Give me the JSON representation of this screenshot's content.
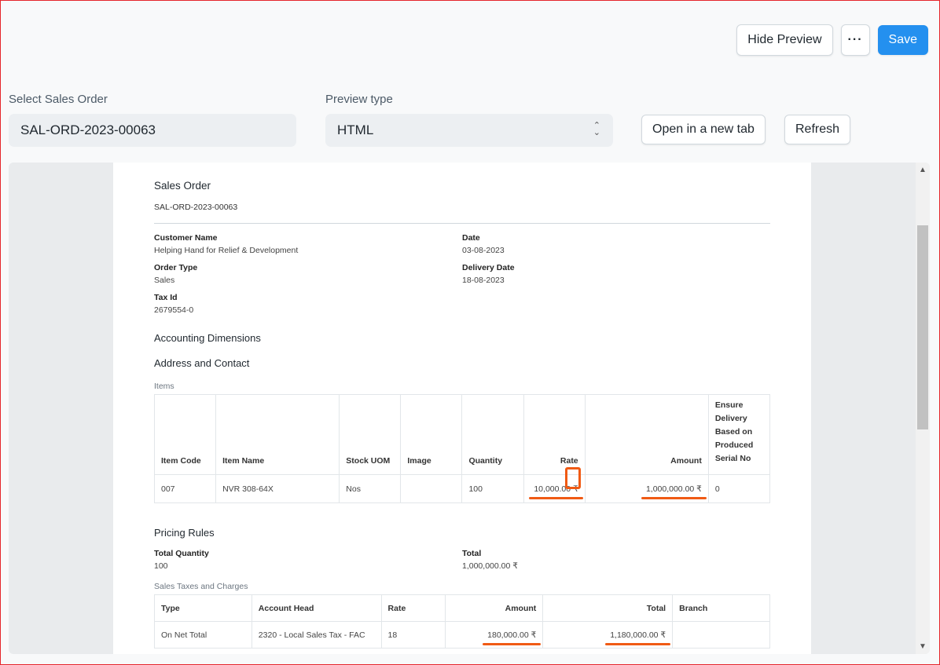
{
  "toolbar": {
    "hide_preview": "Hide Preview",
    "more": "···",
    "save": "Save"
  },
  "form": {
    "sales_order_label": "Select Sales Order",
    "sales_order_value": "SAL-ORD-2023-00063",
    "preview_type_label": "Preview type",
    "preview_type_value": "HTML",
    "open_new_tab": "Open in a new tab",
    "refresh": "Refresh"
  },
  "doc": {
    "title": "Sales Order",
    "name": "SAL-ORD-2023-00063",
    "customer_name_label": "Customer Name",
    "customer_name": "Helping Hand for Relief & Development",
    "date_label": "Date",
    "date": "03-08-2023",
    "order_type_label": "Order Type",
    "order_type": "Sales",
    "delivery_date_label": "Delivery Date",
    "delivery_date": "18-08-2023",
    "tax_id_label": "Tax Id",
    "tax_id": "2679554-0",
    "accounting_dimensions": "Accounting Dimensions",
    "address_contact": "Address and Contact",
    "items_label": "Items",
    "items_headers": [
      "Item Code",
      "Item Name",
      "Stock UOM",
      "Image",
      "Quantity",
      "Rate",
      "Amount",
      "Ensure Delivery Based on Produced Serial No"
    ],
    "items_rows": [
      [
        "007",
        "NVR 308-64X",
        "Nos",
        "",
        "100",
        "10,000.00 ₹",
        "1,000,000.00 ₹",
        "0"
      ]
    ],
    "pricing_rules": "Pricing Rules",
    "total_qty_label": "Total Quantity",
    "total_qty": "100",
    "total_label": "Total",
    "total": "1,000,000.00 ₹",
    "taxes_label": "Sales Taxes and Charges",
    "tax_headers": [
      "Type",
      "Account Head",
      "Rate",
      "Amount",
      "Total",
      "Branch"
    ],
    "tax_rows": [
      [
        "On Net Total",
        "2320 - Local Sales Tax - FAC",
        "18",
        "180,000.00 ₹",
        "1,180,000.00 ₹",
        ""
      ]
    ]
  }
}
